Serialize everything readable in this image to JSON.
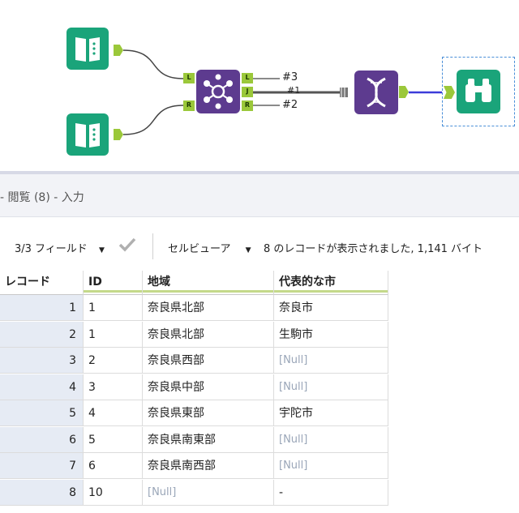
{
  "canvas": {
    "join_left_anchor": "L",
    "join_right_anchor": "R",
    "join_out_left": "L",
    "join_out_join": "J",
    "join_out_right": "R",
    "label_left": "#3",
    "label_join": "#1",
    "label_right": "#2",
    "accent_colors": {
      "input_tool": "#1aa47a",
      "join_tool": "#5d3b8f",
      "anchor": "#9bc83a",
      "selected_wire": "#3b3bd9"
    }
  },
  "results": {
    "title": "- 閲覧 (8) - 入力"
  },
  "toolbar": {
    "field_count": "3/3 フィールド",
    "view_mode": "セルビューア",
    "record_message": "8 のレコードが表示されました, 1,141 バイト"
  },
  "table": {
    "columns": [
      "レコード",
      "ID",
      "地域",
      "代表的な市"
    ],
    "rows": [
      [
        "1",
        "1",
        "奈良県北部",
        "奈良市"
      ],
      [
        "2",
        "1",
        "奈良県北部",
        "生駒市"
      ],
      [
        "3",
        "2",
        "奈良県西部",
        "[Null]"
      ],
      [
        "4",
        "3",
        "奈良県中部",
        "[Null]"
      ],
      [
        "5",
        "4",
        "奈良県東部",
        "宇陀市"
      ],
      [
        "6",
        "5",
        "奈良県南東部",
        "[Null]"
      ],
      [
        "7",
        "6",
        "奈良県南西部",
        "[Null]"
      ],
      [
        "8",
        "10",
        "[Null]",
        "-"
      ]
    ]
  }
}
